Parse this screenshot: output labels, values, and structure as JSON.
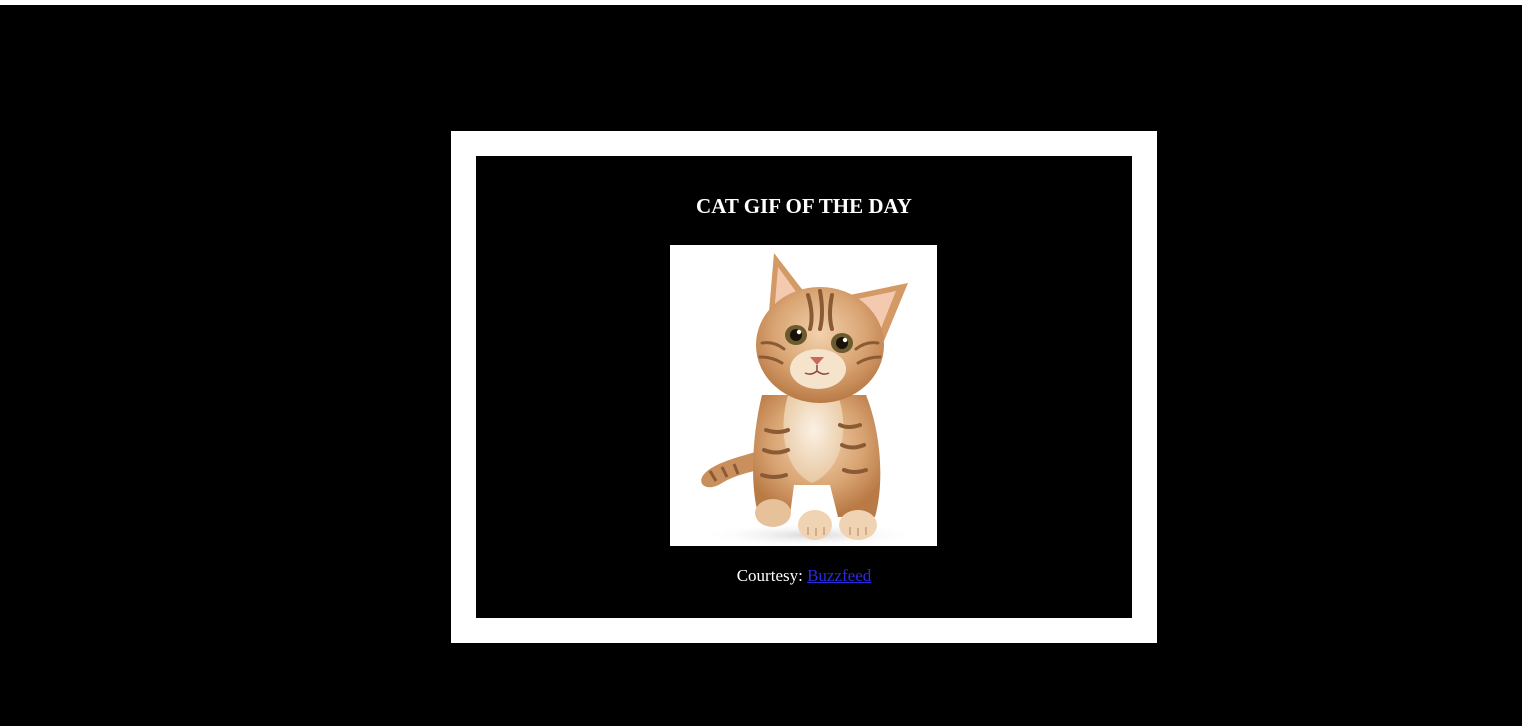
{
  "card": {
    "title": "CAT GIF OF THE DAY",
    "image": {
      "icon": "kitten-photo-icon"
    },
    "credit": {
      "prefix": "Courtesy: ",
      "link_text": "Buzzfeed"
    }
  },
  "colors": {
    "page_background": "#000000",
    "frame": "#ffffff",
    "card_background": "#000000",
    "title_text": "#ffffff",
    "link": "#2a2ae0"
  }
}
